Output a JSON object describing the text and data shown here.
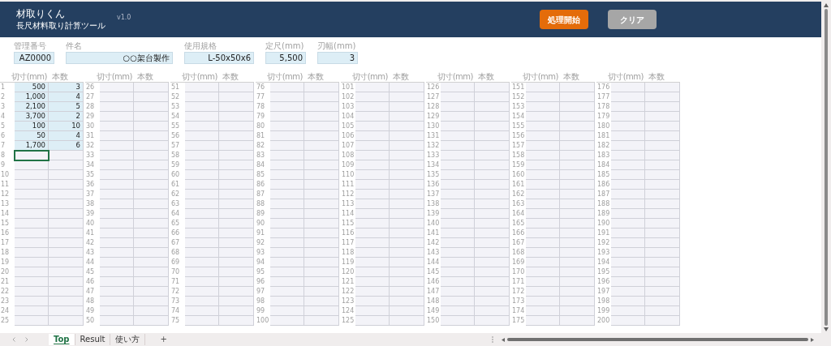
{
  "header": {
    "title": "材取りくん",
    "subtitle": "長尺材料取り計算ツール",
    "version": "v1.0",
    "buttons": [
      {
        "label": "処理開始",
        "kind": "primary"
      },
      {
        "label": "クリア",
        "kind": "secondary"
      }
    ]
  },
  "fields": [
    {
      "label": "管理番号",
      "value": "AZ0000"
    },
    {
      "label": "件名",
      "value": "○○架台製作"
    },
    {
      "label": "使用規格",
      "value": "L-50x50x6"
    },
    {
      "label": "定尺(mm)",
      "value": "5,500"
    },
    {
      "label": "刃幅(mm)",
      "value": "3"
    }
  ],
  "groups": [
    {
      "headers": [
        "切寸(mm)",
        "本数"
      ],
      "rows": [
        {
          "no": "1",
          "cut": "500",
          "qty": "3",
          "selected": false
        },
        {
          "no": "2",
          "cut": "1,000",
          "qty": "4",
          "selected": false
        },
        {
          "no": "3",
          "cut": "2,100",
          "qty": "5",
          "selected": false
        },
        {
          "no": "4",
          "cut": "3,700",
          "qty": "2",
          "selected": false
        },
        {
          "no": "5",
          "cut": "100",
          "qty": "10",
          "selected": false
        },
        {
          "no": "6",
          "cut": "50",
          "qty": "4",
          "selected": false
        },
        {
          "no": "7",
          "cut": "1,700",
          "qty": "6",
          "selected": false
        },
        {
          "no": "8",
          "selected": true
        },
        {
          "no": "9",
          "selected": false
        },
        {
          "no": "10",
          "selected": false
        },
        {
          "no": "11",
          "selected": false
        },
        {
          "no": "12",
          "selected": false
        },
        {
          "no": "13",
          "selected": false
        },
        {
          "no": "14",
          "selected": false
        },
        {
          "no": "15",
          "selected": false
        },
        {
          "no": "16",
          "selected": false
        },
        {
          "no": "17",
          "selected": false
        },
        {
          "no": "18",
          "selected": false
        },
        {
          "no": "19",
          "selected": false
        },
        {
          "no": "20",
          "selected": false
        },
        {
          "no": "21",
          "selected": false
        },
        {
          "no": "22",
          "selected": false
        },
        {
          "no": "23",
          "selected": false
        },
        {
          "no": "24",
          "selected": false
        },
        {
          "no": "25",
          "selected": false
        }
      ]
    },
    {
      "headers": [
        "切寸(mm)",
        "本数"
      ],
      "rows": [
        {
          "no": "26",
          "selected": false
        },
        {
          "no": "27",
          "selected": false
        },
        {
          "no": "28",
          "selected": false
        },
        {
          "no": "29",
          "selected": false
        },
        {
          "no": "30",
          "selected": false
        },
        {
          "no": "31",
          "selected": false
        },
        {
          "no": "32",
          "selected": false
        },
        {
          "no": "33",
          "selected": false
        },
        {
          "no": "34",
          "selected": false
        },
        {
          "no": "35",
          "selected": false
        },
        {
          "no": "36",
          "selected": false
        },
        {
          "no": "37",
          "selected": false
        },
        {
          "no": "38",
          "selected": false
        },
        {
          "no": "39",
          "selected": false
        },
        {
          "no": "40",
          "selected": false
        },
        {
          "no": "41",
          "selected": false
        },
        {
          "no": "42",
          "selected": false
        },
        {
          "no": "43",
          "selected": false
        },
        {
          "no": "44",
          "selected": false
        },
        {
          "no": "45",
          "selected": false
        },
        {
          "no": "46",
          "selected": false
        },
        {
          "no": "47",
          "selected": false
        },
        {
          "no": "48",
          "selected": false
        },
        {
          "no": "49",
          "selected": false
        },
        {
          "no": "50",
          "selected": false
        }
      ]
    },
    {
      "headers": [
        "切寸(mm)",
        "本数"
      ],
      "rows": [
        {
          "no": "51",
          "selected": false
        },
        {
          "no": "52",
          "selected": false
        },
        {
          "no": "53",
          "selected": false
        },
        {
          "no": "54",
          "selected": false
        },
        {
          "no": "55",
          "selected": false
        },
        {
          "no": "56",
          "selected": false
        },
        {
          "no": "57",
          "selected": false
        },
        {
          "no": "58",
          "selected": false
        },
        {
          "no": "59",
          "selected": false
        },
        {
          "no": "60",
          "selected": false
        },
        {
          "no": "61",
          "selected": false
        },
        {
          "no": "62",
          "selected": false
        },
        {
          "no": "63",
          "selected": false
        },
        {
          "no": "64",
          "selected": false
        },
        {
          "no": "65",
          "selected": false
        },
        {
          "no": "66",
          "selected": false
        },
        {
          "no": "67",
          "selected": false
        },
        {
          "no": "68",
          "selected": false
        },
        {
          "no": "69",
          "selected": false
        },
        {
          "no": "70",
          "selected": false
        },
        {
          "no": "71",
          "selected": false
        },
        {
          "no": "72",
          "selected": false
        },
        {
          "no": "73",
          "selected": false
        },
        {
          "no": "74",
          "selected": false
        },
        {
          "no": "75",
          "selected": false
        }
      ]
    },
    {
      "headers": [
        "切寸(mm)",
        "本数"
      ],
      "rows": [
        {
          "no": "76",
          "selected": false
        },
        {
          "no": "77",
          "selected": false
        },
        {
          "no": "78",
          "selected": false
        },
        {
          "no": "79",
          "selected": false
        },
        {
          "no": "80",
          "selected": false
        },
        {
          "no": "81",
          "selected": false
        },
        {
          "no": "82",
          "selected": false
        },
        {
          "no": "83",
          "selected": false
        },
        {
          "no": "84",
          "selected": false
        },
        {
          "no": "85",
          "selected": false
        },
        {
          "no": "86",
          "selected": false
        },
        {
          "no": "87",
          "selected": false
        },
        {
          "no": "88",
          "selected": false
        },
        {
          "no": "89",
          "selected": false
        },
        {
          "no": "90",
          "selected": false
        },
        {
          "no": "91",
          "selected": false
        },
        {
          "no": "92",
          "selected": false
        },
        {
          "no": "93",
          "selected": false
        },
        {
          "no": "94",
          "selected": false
        },
        {
          "no": "95",
          "selected": false
        },
        {
          "no": "96",
          "selected": false
        },
        {
          "no": "97",
          "selected": false
        },
        {
          "no": "98",
          "selected": false
        },
        {
          "no": "99",
          "selected": false
        },
        {
          "no": "100",
          "selected": false
        }
      ]
    },
    {
      "headers": [
        "切寸(mm)",
        "本数"
      ],
      "rows": [
        {
          "no": "101",
          "selected": false
        },
        {
          "no": "102",
          "selected": false
        },
        {
          "no": "103",
          "selected": false
        },
        {
          "no": "104",
          "selected": false
        },
        {
          "no": "105",
          "selected": false
        },
        {
          "no": "106",
          "selected": false
        },
        {
          "no": "107",
          "selected": false
        },
        {
          "no": "108",
          "selected": false
        },
        {
          "no": "109",
          "selected": false
        },
        {
          "no": "110",
          "selected": false
        },
        {
          "no": "111",
          "selected": false
        },
        {
          "no": "112",
          "selected": false
        },
        {
          "no": "113",
          "selected": false
        },
        {
          "no": "114",
          "selected": false
        },
        {
          "no": "115",
          "selected": false
        },
        {
          "no": "116",
          "selected": false
        },
        {
          "no": "117",
          "selected": false
        },
        {
          "no": "118",
          "selected": false
        },
        {
          "no": "119",
          "selected": false
        },
        {
          "no": "120",
          "selected": false
        },
        {
          "no": "121",
          "selected": false
        },
        {
          "no": "122",
          "selected": false
        },
        {
          "no": "123",
          "selected": false
        },
        {
          "no": "124",
          "selected": false
        },
        {
          "no": "125",
          "selected": false
        }
      ]
    },
    {
      "headers": [
        "切寸(mm)",
        "本数"
      ],
      "rows": [
        {
          "no": "126",
          "selected": false
        },
        {
          "no": "127",
          "selected": false
        },
        {
          "no": "128",
          "selected": false
        },
        {
          "no": "129",
          "selected": false
        },
        {
          "no": "130",
          "selected": false
        },
        {
          "no": "131",
          "selected": false
        },
        {
          "no": "132",
          "selected": false
        },
        {
          "no": "133",
          "selected": false
        },
        {
          "no": "134",
          "selected": false
        },
        {
          "no": "135",
          "selected": false
        },
        {
          "no": "136",
          "selected": false
        },
        {
          "no": "137",
          "selected": false
        },
        {
          "no": "138",
          "selected": false
        },
        {
          "no": "139",
          "selected": false
        },
        {
          "no": "140",
          "selected": false
        },
        {
          "no": "141",
          "selected": false
        },
        {
          "no": "142",
          "selected": false
        },
        {
          "no": "143",
          "selected": false
        },
        {
          "no": "144",
          "selected": false
        },
        {
          "no": "145",
          "selected": false
        },
        {
          "no": "146",
          "selected": false
        },
        {
          "no": "147",
          "selected": false
        },
        {
          "no": "148",
          "selected": false
        },
        {
          "no": "149",
          "selected": false
        },
        {
          "no": "150",
          "selected": false
        }
      ]
    },
    {
      "headers": [
        "切寸(mm)",
        "本数"
      ],
      "rows": [
        {
          "no": "151",
          "selected": false
        },
        {
          "no": "152",
          "selected": false
        },
        {
          "no": "153",
          "selected": false
        },
        {
          "no": "154",
          "selected": false
        },
        {
          "no": "155",
          "selected": false
        },
        {
          "no": "156",
          "selected": false
        },
        {
          "no": "157",
          "selected": false
        },
        {
          "no": "158",
          "selected": false
        },
        {
          "no": "159",
          "selected": false
        },
        {
          "no": "160",
          "selected": false
        },
        {
          "no": "161",
          "selected": false
        },
        {
          "no": "162",
          "selected": false
        },
        {
          "no": "163",
          "selected": false
        },
        {
          "no": "164",
          "selected": false
        },
        {
          "no": "165",
          "selected": false
        },
        {
          "no": "166",
          "selected": false
        },
        {
          "no": "167",
          "selected": false
        },
        {
          "no": "168",
          "selected": false
        },
        {
          "no": "169",
          "selected": false
        },
        {
          "no": "170",
          "selected": false
        },
        {
          "no": "171",
          "selected": false
        },
        {
          "no": "172",
          "selected": false
        },
        {
          "no": "173",
          "selected": false
        },
        {
          "no": "174",
          "selected": false
        },
        {
          "no": "175",
          "selected": false
        }
      ]
    },
    {
      "headers": [
        "切寸(mm)",
        "本数"
      ],
      "rows": [
        {
          "no": "176",
          "selected": false
        },
        {
          "no": "177",
          "selected": false
        },
        {
          "no": "178",
          "selected": false
        },
        {
          "no": "179",
          "selected": false
        },
        {
          "no": "180",
          "selected": false
        },
        {
          "no": "181",
          "selected": false
        },
        {
          "no": "182",
          "selected": false
        },
        {
          "no": "183",
          "selected": false
        },
        {
          "no": "184",
          "selected": false
        },
        {
          "no": "185",
          "selected": false
        },
        {
          "no": "186",
          "selected": false
        },
        {
          "no": "187",
          "selected": false
        },
        {
          "no": "188",
          "selected": false
        },
        {
          "no": "189",
          "selected": false
        },
        {
          "no": "190",
          "selected": false
        },
        {
          "no": "191",
          "selected": false
        },
        {
          "no": "192",
          "selected": false
        },
        {
          "no": "193",
          "selected": false
        },
        {
          "no": "194",
          "selected": false
        },
        {
          "no": "195",
          "selected": false
        },
        {
          "no": "196",
          "selected": false
        },
        {
          "no": "197",
          "selected": false
        },
        {
          "no": "198",
          "selected": false
        },
        {
          "no": "199",
          "selected": false
        },
        {
          "no": "200",
          "selected": false
        }
      ]
    }
  ],
  "sheet_tabs": [
    {
      "label": "Top",
      "selected": true
    },
    {
      "label": "Result",
      "selected": false
    },
    {
      "label": "使い方",
      "selected": false
    }
  ],
  "add_sheet": "+"
}
